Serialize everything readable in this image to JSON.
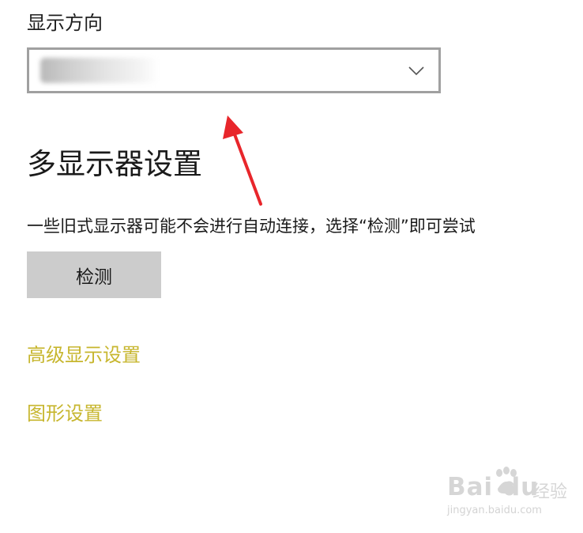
{
  "display_orientation": {
    "label": "显示方向",
    "dropdown_value": "",
    "chevron_icon": "chevron-down-icon"
  },
  "multi_display": {
    "heading": "多显示器设置",
    "description": "一些旧式显示器可能不会进行自动连接，选择“检测”即可尝试",
    "detect_button_label": "检测"
  },
  "links": {
    "advanced_display_settings": "高级显示设置",
    "graphics_settings": "图形设置"
  },
  "watermark": {
    "logo_text": "Bai  du",
    "jingyan": "经验",
    "url": "jingyan.baidu.com"
  },
  "colors": {
    "link": "#c7b62e",
    "annotation_arrow": "#e8262b",
    "button_bg": "#cccccc",
    "dropdown_border": "#a0a0a0"
  }
}
